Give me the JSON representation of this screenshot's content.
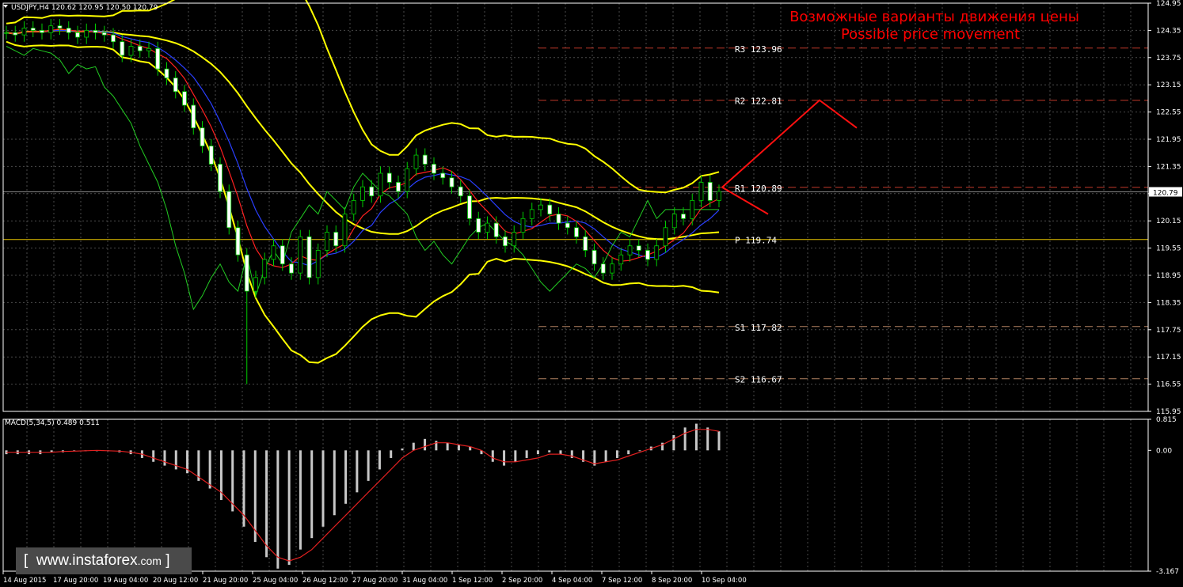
{
  "chart_data": {
    "type": "candlestick",
    "symbol_header": "USDJPY,H4  120.62 120.95 120.50 120.79",
    "annotation": {
      "line1": "Возможные варианты движения цены",
      "line2": "Possible price movement",
      "color": "#ff0000"
    },
    "price_axis": {
      "ylim": [
        115.95,
        124.95
      ],
      "ticks": [
        "124.95",
        "124.35",
        "123.75",
        "123.15",
        "122.55",
        "121.95",
        "121.35",
        "120.75",
        "120.15",
        "119.55",
        "118.95",
        "118.35",
        "117.75",
        "117.15",
        "116.55",
        "115.95"
      ],
      "current_price": "120.79"
    },
    "levels": [
      {
        "label": "R3 123.96",
        "value": 123.96,
        "color": "#c0392b"
      },
      {
        "label": "R2 122.81",
        "value": 122.81,
        "color": "#c0392b"
      },
      {
        "label": "R1 120.89",
        "value": 120.89,
        "color": "#c0392b"
      },
      {
        "label": "P 119.74",
        "value": 119.74,
        "color": "#e6c200"
      },
      {
        "label": "S1 117.82",
        "value": 117.82,
        "color": "#b08060"
      },
      {
        "label": "S2 116.67",
        "value": 116.67,
        "color": "#b08060"
      }
    ],
    "time_axis": [
      "14 Aug 2015",
      "17 Aug 20:00",
      "19 Aug 04:00",
      "20 Aug 12:00",
      "21 Aug 20:00",
      "25 Aug 04:00",
      "26 Aug 12:00",
      "27 Aug 20:00",
      "31 Aug 04:00",
      "1 Sep 12:00",
      "2 Sep 20:00",
      "4 Sep 04:00",
      "7 Sep 12:00",
      "8 Sep 20:00",
      "10 Sep 04:00"
    ],
    "close_series": [
      124.3,
      124.25,
      124.4,
      124.35,
      124.3,
      124.45,
      124.4,
      124.3,
      124.2,
      124.35,
      124.3,
      124.25,
      124.1,
      123.8,
      124.0,
      123.9,
      123.95,
      123.5,
      123.3,
      123.0,
      122.7,
      122.2,
      121.8,
      121.4,
      120.8,
      120.0,
      119.4,
      118.6,
      118.9,
      119.3,
      119.6,
      119.2,
      119.0,
      119.8,
      118.9,
      119.5,
      119.9,
      119.6,
      120.3,
      120.6,
      120.9,
      120.7,
      121.2,
      121.0,
      120.8,
      121.3,
      121.6,
      121.4,
      121.2,
      121.1,
      120.9,
      120.7,
      120.2,
      119.9,
      120.1,
      119.8,
      119.6,
      119.9,
      120.2,
      120.4,
      120.5,
      120.3,
      120.1,
      120.0,
      119.8,
      119.5,
      119.2,
      119.0,
      119.2,
      119.4,
      119.6,
      119.5,
      119.3,
      119.6,
      120.0,
      120.3,
      120.2,
      120.6,
      121.0,
      120.6,
      120.8
    ],
    "macd": {
      "label": "MACD(5,34,5) 0.489 0.511",
      "ylim": [
        -3.167,
        0.815
      ],
      "ticks": [
        "0.815",
        "0.00",
        "-3.167"
      ],
      "histogram": [
        -0.1,
        -0.1,
        -0.1,
        -0.1,
        -0.05,
        -0.05,
        0.0,
        0.0,
        0.0,
        -0.02,
        -0.05,
        -0.1,
        -0.2,
        -0.3,
        -0.4,
        -0.5,
        -0.6,
        -0.8,
        -1.0,
        -1.3,
        -1.6,
        -2.0,
        -2.4,
        -2.8,
        -3.1,
        -3.0,
        -2.6,
        -2.3,
        -2.0,
        -1.7,
        -1.4,
        -1.1,
        -0.8,
        -0.5,
        -0.2,
        0.05,
        0.2,
        0.3,
        0.25,
        0.2,
        0.15,
        0.1,
        -0.1,
        -0.3,
        -0.4,
        -0.3,
        -0.2,
        -0.1,
        -0.05,
        -0.1,
        -0.2,
        -0.3,
        -0.4,
        -0.3,
        -0.2,
        -0.1,
        0.0,
        0.1,
        0.2,
        0.4,
        0.6,
        0.7,
        0.6,
        0.5
      ],
      "signal": [
        -0.05,
        -0.05,
        -0.05,
        -0.05,
        -0.05,
        -0.03,
        -0.02,
        -0.01,
        0.0,
        -0.01,
        -0.02,
        -0.05,
        -0.1,
        -0.2,
        -0.3,
        -0.4,
        -0.5,
        -0.7,
        -0.9,
        -1.1,
        -1.4,
        -1.7,
        -2.1,
        -2.5,
        -2.8,
        -2.9,
        -2.8,
        -2.6,
        -2.3,
        -2.0,
        -1.7,
        -1.4,
        -1.1,
        -0.8,
        -0.5,
        -0.2,
        0.0,
        0.1,
        0.2,
        0.2,
        0.15,
        0.1,
        0.0,
        -0.2,
        -0.3,
        -0.3,
        -0.25,
        -0.2,
        -0.1,
        -0.1,
        -0.15,
        -0.25,
        -0.35,
        -0.3,
        -0.25,
        -0.15,
        -0.05,
        0.05,
        0.15,
        0.3,
        0.45,
        0.55,
        0.55,
        0.5
      ]
    },
    "watermark": {
      "bracket_l": "[",
      "site": "www.instaforex",
      "tld": ".com",
      "bracket_r": "]"
    }
  }
}
